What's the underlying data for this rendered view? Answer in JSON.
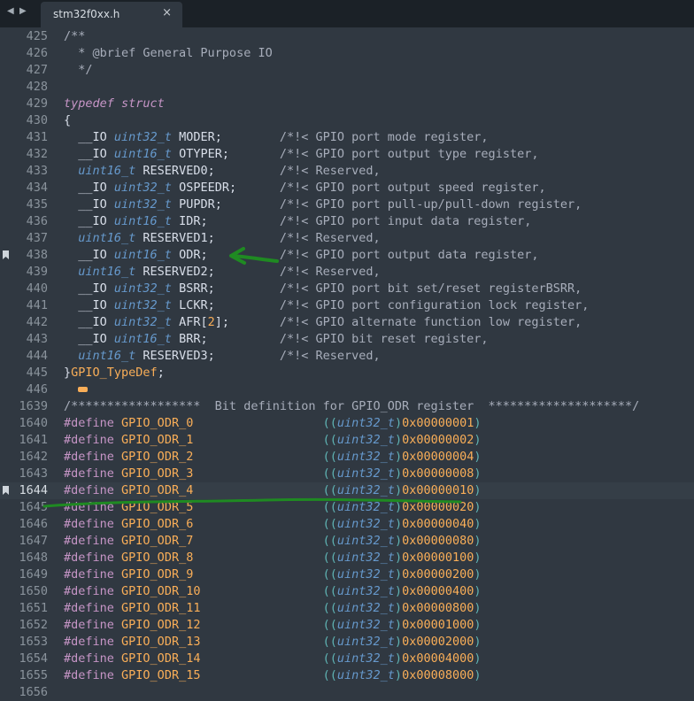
{
  "tab": {
    "title": "stm32f0xx.h",
    "close_glyph": "×",
    "nav_left": "◀",
    "nav_right": "▶"
  },
  "current_line": "1644",
  "bookmarked_lines": [
    "438",
    "1644"
  ],
  "lines": [
    {
      "n": "425",
      "t": [
        {
          "s": "c-cm",
          "x": "/**"
        }
      ]
    },
    {
      "n": "426",
      "t": [
        {
          "s": "c-cm",
          "x": "  * @brief General Purpose IO"
        }
      ]
    },
    {
      "n": "427",
      "t": [
        {
          "s": "c-cm",
          "x": "  */"
        }
      ]
    },
    {
      "n": "428",
      "t": []
    },
    {
      "n": "429",
      "t": [
        {
          "s": "c-kw",
          "x": "typedef"
        },
        {
          "s": "",
          "x": " "
        },
        {
          "s": "c-kw",
          "x": "struct"
        }
      ]
    },
    {
      "n": "430",
      "t": [
        {
          "s": "",
          "x": "{"
        }
      ]
    },
    {
      "n": "431",
      "t": [
        {
          "s": "",
          "x": "  __IO "
        },
        {
          "s": "c-ty",
          "x": "uint32_t"
        },
        {
          "s": "",
          "x": " MODER;        "
        },
        {
          "s": "c-cm",
          "x": "/*!< GPIO port mode register,"
        }
      ]
    },
    {
      "n": "432",
      "t": [
        {
          "s": "",
          "x": "  __IO "
        },
        {
          "s": "c-ty",
          "x": "uint16_t"
        },
        {
          "s": "",
          "x": " OTYPER;       "
        },
        {
          "s": "c-cm",
          "x": "/*!< GPIO port output type register,"
        }
      ]
    },
    {
      "n": "433",
      "t": [
        {
          "s": "",
          "x": "  "
        },
        {
          "s": "c-ty",
          "x": "uint16_t"
        },
        {
          "s": "",
          "x": " RESERVED0;         "
        },
        {
          "s": "c-cm",
          "x": "/*!< Reserved,"
        }
      ]
    },
    {
      "n": "434",
      "t": [
        {
          "s": "",
          "x": "  __IO "
        },
        {
          "s": "c-ty",
          "x": "uint32_t"
        },
        {
          "s": "",
          "x": " OSPEEDR;      "
        },
        {
          "s": "c-cm",
          "x": "/*!< GPIO port output speed register,"
        }
      ]
    },
    {
      "n": "435",
      "t": [
        {
          "s": "",
          "x": "  __IO "
        },
        {
          "s": "c-ty",
          "x": "uint32_t"
        },
        {
          "s": "",
          "x": " PUPDR;        "
        },
        {
          "s": "c-cm",
          "x": "/*!< GPIO port pull-up/pull-down register,"
        }
      ]
    },
    {
      "n": "436",
      "t": [
        {
          "s": "",
          "x": "  __IO "
        },
        {
          "s": "c-ty",
          "x": "uint16_t"
        },
        {
          "s": "",
          "x": " IDR;          "
        },
        {
          "s": "c-cm",
          "x": "/*!< GPIO port input data register,"
        }
      ]
    },
    {
      "n": "437",
      "t": [
        {
          "s": "",
          "x": "  "
        },
        {
          "s": "c-ty",
          "x": "uint16_t"
        },
        {
          "s": "",
          "x": " RESERVED1;         "
        },
        {
          "s": "c-cm",
          "x": "/*!< Reserved,"
        }
      ]
    },
    {
      "n": "438",
      "t": [
        {
          "s": "",
          "x": "  __IO "
        },
        {
          "s": "c-ty",
          "x": "uint16_t"
        },
        {
          "s": "",
          "x": " ODR;          "
        },
        {
          "s": "c-cm",
          "x": "/*!< GPIO port output data register,"
        }
      ]
    },
    {
      "n": "439",
      "t": [
        {
          "s": "",
          "x": "  "
        },
        {
          "s": "c-ty",
          "x": "uint16_t"
        },
        {
          "s": "",
          "x": " RESERVED2;         "
        },
        {
          "s": "c-cm",
          "x": "/*!< Reserved,"
        }
      ]
    },
    {
      "n": "440",
      "t": [
        {
          "s": "",
          "x": "  __IO "
        },
        {
          "s": "c-ty",
          "x": "uint32_t"
        },
        {
          "s": "",
          "x": " BSRR;         "
        },
        {
          "s": "c-cm",
          "x": "/*!< GPIO port bit set/reset registerBSRR,"
        }
      ]
    },
    {
      "n": "441",
      "t": [
        {
          "s": "",
          "x": "  __IO "
        },
        {
          "s": "c-ty",
          "x": "uint32_t"
        },
        {
          "s": "",
          "x": " LCKR;         "
        },
        {
          "s": "c-cm",
          "x": "/*!< GPIO port configuration lock register,"
        }
      ]
    },
    {
      "n": "442",
      "t": [
        {
          "s": "",
          "x": "  __IO "
        },
        {
          "s": "c-ty",
          "x": "uint32_t"
        },
        {
          "s": "",
          "x": " AFR["
        },
        {
          "s": "c-num",
          "x": "2"
        },
        {
          "s": "",
          "x": "];       "
        },
        {
          "s": "c-cm",
          "x": "/*!< GPIO alternate function low register,"
        }
      ]
    },
    {
      "n": "443",
      "t": [
        {
          "s": "",
          "x": "  __IO "
        },
        {
          "s": "c-ty",
          "x": "uint16_t"
        },
        {
          "s": "",
          "x": " BRR;          "
        },
        {
          "s": "c-cm",
          "x": "/*!< GPIO bit reset register,"
        }
      ]
    },
    {
      "n": "444",
      "t": [
        {
          "s": "",
          "x": "  "
        },
        {
          "s": "c-ty",
          "x": "uint16_t"
        },
        {
          "s": "",
          "x": " RESERVED3;         "
        },
        {
          "s": "c-cm",
          "x": "/*!< Reserved,"
        }
      ]
    },
    {
      "n": "445",
      "t": [
        {
          "s": "",
          "x": "}"
        },
        {
          "s": "c-tn",
          "x": "GPIO_TypeDef"
        },
        {
          "s": "",
          "x": ";"
        }
      ]
    },
    {
      "n": "446",
      "fold": true,
      "t": []
    },
    {
      "n": "1639",
      "t": [
        {
          "s": "c-cm",
          "x": "/******************  Bit definition for GPIO_ODR register  ********************/"
        }
      ]
    },
    {
      "n": "1640",
      "t": [
        {
          "s": "c-pp",
          "x": "#define"
        },
        {
          "s": "",
          "x": " "
        },
        {
          "s": "c-mac",
          "x": "GPIO_ODR_0"
        },
        {
          "s": "",
          "x": "                  "
        },
        {
          "s": "c-br",
          "x": "(("
        },
        {
          "s": "c-ty",
          "x": "uint32_t"
        },
        {
          "s": "c-br",
          "x": ")"
        },
        {
          "s": "c-num",
          "x": "0x00000001"
        },
        {
          "s": "c-br",
          "x": ")"
        }
      ]
    },
    {
      "n": "1641",
      "t": [
        {
          "s": "c-pp",
          "x": "#define"
        },
        {
          "s": "",
          "x": " "
        },
        {
          "s": "c-mac",
          "x": "GPIO_ODR_1"
        },
        {
          "s": "",
          "x": "                  "
        },
        {
          "s": "c-br",
          "x": "(("
        },
        {
          "s": "c-ty",
          "x": "uint32_t"
        },
        {
          "s": "c-br",
          "x": ")"
        },
        {
          "s": "c-num",
          "x": "0x00000002"
        },
        {
          "s": "c-br",
          "x": ")"
        }
      ]
    },
    {
      "n": "1642",
      "t": [
        {
          "s": "c-pp",
          "x": "#define"
        },
        {
          "s": "",
          "x": " "
        },
        {
          "s": "c-mac",
          "x": "GPIO_ODR_2"
        },
        {
          "s": "",
          "x": "                  "
        },
        {
          "s": "c-br",
          "x": "(("
        },
        {
          "s": "c-ty",
          "x": "uint32_t"
        },
        {
          "s": "c-br",
          "x": ")"
        },
        {
          "s": "c-num",
          "x": "0x00000004"
        },
        {
          "s": "c-br",
          "x": ")"
        }
      ]
    },
    {
      "n": "1643",
      "t": [
        {
          "s": "c-pp",
          "x": "#define"
        },
        {
          "s": "",
          "x": " "
        },
        {
          "s": "c-mac",
          "x": "GPIO_ODR_3"
        },
        {
          "s": "",
          "x": "                  "
        },
        {
          "s": "c-br",
          "x": "(("
        },
        {
          "s": "c-ty",
          "x": "uint32_t"
        },
        {
          "s": "c-br",
          "x": ")"
        },
        {
          "s": "c-num",
          "x": "0x00000008"
        },
        {
          "s": "c-br",
          "x": ")"
        }
      ]
    },
    {
      "n": "1644",
      "t": [
        {
          "s": "c-pp",
          "x": "#define"
        },
        {
          "s": "",
          "x": " "
        },
        {
          "s": "c-mac",
          "x": "GPIO_ODR_4"
        },
        {
          "s": "",
          "x": "                  "
        },
        {
          "s": "c-br",
          "x": "(("
        },
        {
          "s": "c-ty",
          "x": "uint32_t"
        },
        {
          "s": "c-br",
          "x": ")"
        },
        {
          "s": "c-num",
          "x": "0x00000010"
        },
        {
          "s": "c-br",
          "x": ")"
        }
      ]
    },
    {
      "n": "1645",
      "t": [
        {
          "s": "c-pp",
          "x": "#define"
        },
        {
          "s": "",
          "x": " "
        },
        {
          "s": "c-mac",
          "x": "GPIO_ODR_5"
        },
        {
          "s": "",
          "x": "                  "
        },
        {
          "s": "c-br",
          "x": "(("
        },
        {
          "s": "c-ty",
          "x": "uint32_t"
        },
        {
          "s": "c-br",
          "x": ")"
        },
        {
          "s": "c-num",
          "x": "0x00000020"
        },
        {
          "s": "c-br",
          "x": ")"
        }
      ]
    },
    {
      "n": "1646",
      "t": [
        {
          "s": "c-pp",
          "x": "#define"
        },
        {
          "s": "",
          "x": " "
        },
        {
          "s": "c-mac",
          "x": "GPIO_ODR_6"
        },
        {
          "s": "",
          "x": "                  "
        },
        {
          "s": "c-br",
          "x": "(("
        },
        {
          "s": "c-ty",
          "x": "uint32_t"
        },
        {
          "s": "c-br",
          "x": ")"
        },
        {
          "s": "c-num",
          "x": "0x00000040"
        },
        {
          "s": "c-br",
          "x": ")"
        }
      ]
    },
    {
      "n": "1647",
      "t": [
        {
          "s": "c-pp",
          "x": "#define"
        },
        {
          "s": "",
          "x": " "
        },
        {
          "s": "c-mac",
          "x": "GPIO_ODR_7"
        },
        {
          "s": "",
          "x": "                  "
        },
        {
          "s": "c-br",
          "x": "(("
        },
        {
          "s": "c-ty",
          "x": "uint32_t"
        },
        {
          "s": "c-br",
          "x": ")"
        },
        {
          "s": "c-num",
          "x": "0x00000080"
        },
        {
          "s": "c-br",
          "x": ")"
        }
      ]
    },
    {
      "n": "1648",
      "t": [
        {
          "s": "c-pp",
          "x": "#define"
        },
        {
          "s": "",
          "x": " "
        },
        {
          "s": "c-mac",
          "x": "GPIO_ODR_8"
        },
        {
          "s": "",
          "x": "                  "
        },
        {
          "s": "c-br",
          "x": "(("
        },
        {
          "s": "c-ty",
          "x": "uint32_t"
        },
        {
          "s": "c-br",
          "x": ")"
        },
        {
          "s": "c-num",
          "x": "0x00000100"
        },
        {
          "s": "c-br",
          "x": ")"
        }
      ]
    },
    {
      "n": "1649",
      "t": [
        {
          "s": "c-pp",
          "x": "#define"
        },
        {
          "s": "",
          "x": " "
        },
        {
          "s": "c-mac",
          "x": "GPIO_ODR_9"
        },
        {
          "s": "",
          "x": "                  "
        },
        {
          "s": "c-br",
          "x": "(("
        },
        {
          "s": "c-ty",
          "x": "uint32_t"
        },
        {
          "s": "c-br",
          "x": ")"
        },
        {
          "s": "c-num",
          "x": "0x00000200"
        },
        {
          "s": "c-br",
          "x": ")"
        }
      ]
    },
    {
      "n": "1650",
      "t": [
        {
          "s": "c-pp",
          "x": "#define"
        },
        {
          "s": "",
          "x": " "
        },
        {
          "s": "c-mac",
          "x": "GPIO_ODR_10"
        },
        {
          "s": "",
          "x": "                 "
        },
        {
          "s": "c-br",
          "x": "(("
        },
        {
          "s": "c-ty",
          "x": "uint32_t"
        },
        {
          "s": "c-br",
          "x": ")"
        },
        {
          "s": "c-num",
          "x": "0x00000400"
        },
        {
          "s": "c-br",
          "x": ")"
        }
      ]
    },
    {
      "n": "1651",
      "t": [
        {
          "s": "c-pp",
          "x": "#define"
        },
        {
          "s": "",
          "x": " "
        },
        {
          "s": "c-mac",
          "x": "GPIO_ODR_11"
        },
        {
          "s": "",
          "x": "                 "
        },
        {
          "s": "c-br",
          "x": "(("
        },
        {
          "s": "c-ty",
          "x": "uint32_t"
        },
        {
          "s": "c-br",
          "x": ")"
        },
        {
          "s": "c-num",
          "x": "0x00000800"
        },
        {
          "s": "c-br",
          "x": ")"
        }
      ]
    },
    {
      "n": "1652",
      "t": [
        {
          "s": "c-pp",
          "x": "#define"
        },
        {
          "s": "",
          "x": " "
        },
        {
          "s": "c-mac",
          "x": "GPIO_ODR_12"
        },
        {
          "s": "",
          "x": "                 "
        },
        {
          "s": "c-br",
          "x": "(("
        },
        {
          "s": "c-ty",
          "x": "uint32_t"
        },
        {
          "s": "c-br",
          "x": ")"
        },
        {
          "s": "c-num",
          "x": "0x00001000"
        },
        {
          "s": "c-br",
          "x": ")"
        }
      ]
    },
    {
      "n": "1653",
      "t": [
        {
          "s": "c-pp",
          "x": "#define"
        },
        {
          "s": "",
          "x": " "
        },
        {
          "s": "c-mac",
          "x": "GPIO_ODR_13"
        },
        {
          "s": "",
          "x": "                 "
        },
        {
          "s": "c-br",
          "x": "(("
        },
        {
          "s": "c-ty",
          "x": "uint32_t"
        },
        {
          "s": "c-br",
          "x": ")"
        },
        {
          "s": "c-num",
          "x": "0x00002000"
        },
        {
          "s": "c-br",
          "x": ")"
        }
      ]
    },
    {
      "n": "1654",
      "t": [
        {
          "s": "c-pp",
          "x": "#define"
        },
        {
          "s": "",
          "x": " "
        },
        {
          "s": "c-mac",
          "x": "GPIO_ODR_14"
        },
        {
          "s": "",
          "x": "                 "
        },
        {
          "s": "c-br",
          "x": "(("
        },
        {
          "s": "c-ty",
          "x": "uint32_t"
        },
        {
          "s": "c-br",
          "x": ")"
        },
        {
          "s": "c-num",
          "x": "0x00004000"
        },
        {
          "s": "c-br",
          "x": ")"
        }
      ]
    },
    {
      "n": "1655",
      "t": [
        {
          "s": "c-pp",
          "x": "#define"
        },
        {
          "s": "",
          "x": " "
        },
        {
          "s": "c-mac",
          "x": "GPIO_ODR_15"
        },
        {
          "s": "",
          "x": "                 "
        },
        {
          "s": "c-br",
          "x": "(("
        },
        {
          "s": "c-ty",
          "x": "uint32_t"
        },
        {
          "s": "c-br",
          "x": ")"
        },
        {
          "s": "c-num",
          "x": "0x00008000"
        },
        {
          "s": "c-br",
          "x": ")"
        }
      ]
    },
    {
      "n": "1656",
      "t": []
    }
  ],
  "annotations": {
    "ink_color": "#1f8a22"
  }
}
